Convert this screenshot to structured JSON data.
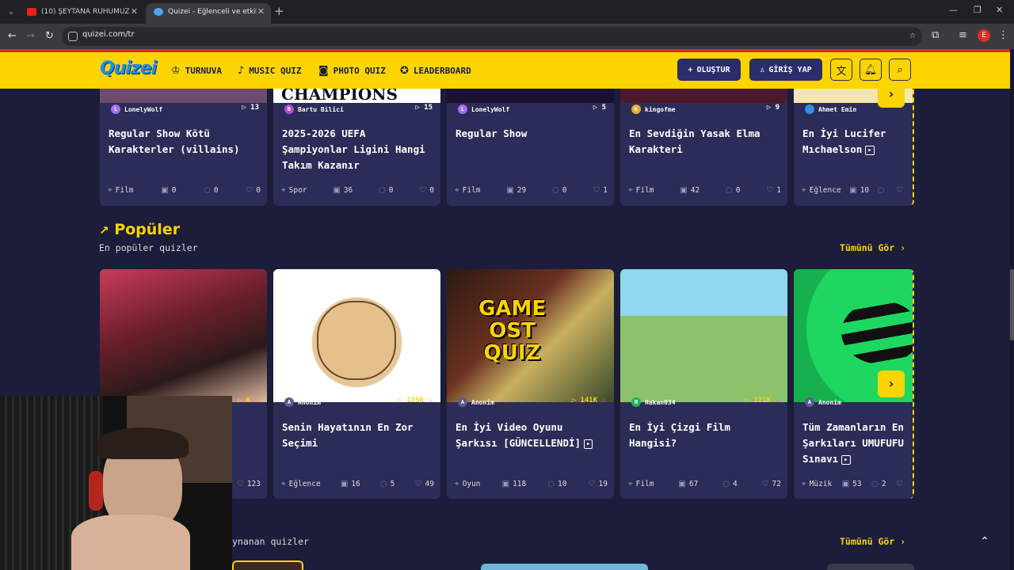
{
  "browser": {
    "tabs": [
      {
        "title": "(10) ŞEYTANA RUHUMUZU SAT"
      },
      {
        "title": "Quizei - Eğlenceli ve etkileşimli"
      }
    ],
    "url": "quizei.com/tr",
    "profile_initial": "E"
  },
  "header": {
    "logo": "Quizei",
    "nav": [
      {
        "label": "TURNUVA",
        "icon": "trophy-icon"
      },
      {
        "label": "MUSIC QUIZ",
        "icon": "music-note-icon"
      },
      {
        "label": "PHOTO QUIZ",
        "icon": "camera-icon"
      },
      {
        "label": "LEADERBOARD",
        "icon": "medal-icon"
      }
    ],
    "create_label": "OLUŞTUR",
    "login_label": "GİRİŞ YAP"
  },
  "top_row": [
    {
      "author": "LonelyWolf",
      "plays": "13",
      "title": "Regular Show Kötü Karakterler (villains)",
      "category": "Film",
      "questions": "0",
      "comments": "0",
      "likes": "0",
      "avatar_color": "#a36df0",
      "avatar_letter": "L"
    },
    {
      "author": "Bartu Bilici",
      "plays": "15",
      "title": "2025-2026 UEFA Şampiyonlar Ligini Hangi Takım Kazanır",
      "category": "Spor",
      "questions": "36",
      "comments": "0",
      "likes": "0",
      "avatar_color": "#b44ad8",
      "avatar_letter": "B",
      "banner": "CHAMPIONS"
    },
    {
      "author": "LonelyWolf",
      "plays": "5",
      "title": "Regular Show",
      "category": "Film",
      "questions": "29",
      "comments": "0",
      "likes": "1",
      "avatar_color": "#a36df0",
      "avatar_letter": "L"
    },
    {
      "author": "kingofme",
      "plays": "9",
      "title": "En Sevdiğin Yasak Elma Karakteri",
      "category": "Film",
      "questions": "42",
      "comments": "0",
      "likes": "1",
      "avatar_color": "#e8a533",
      "avatar_letter": "K"
    },
    {
      "author": "Ahmet Emin",
      "plays": "",
      "title": "En İyi Lucifer Mıchaelson",
      "category": "Eğlence",
      "questions": "10",
      "comments": "",
      "likes": "",
      "avatar_color": "#3a8de0",
      "avatar_letter": ""
    }
  ],
  "popular": {
    "title": "Popüler",
    "subtitle": "En popüler quizler",
    "see_all": "Tümünü Gör",
    "cards": [
      {
        "author": "",
        "plays": "K",
        "title": "",
        "category": "",
        "questions": "",
        "comments": "",
        "likes": "123",
        "avatar_color": "#666",
        "avatar_letter": ""
      },
      {
        "author": "Anonim",
        "plays": "155K",
        "title": "Senin Hayatının En Zor Seçimi",
        "category": "Eğlence",
        "questions": "16",
        "comments": "5",
        "likes": "49",
        "avatar_color": "#5a5c8a",
        "avatar_letter": "A"
      },
      {
        "author": "Anonim",
        "plays": "141K",
        "title": "En İyi Video Oyunu Şarkısı [GÜNCELLENDİ]",
        "category": "Oyun",
        "questions": "118",
        "comments": "10",
        "likes": "19",
        "avatar_color": "#5a5c8a",
        "avatar_letter": "A",
        "overlay": [
          "GAME",
          "OST",
          "QUIZ"
        ]
      },
      {
        "author": "Hakan034",
        "plays": "121K",
        "title": "En İyi Çizgi Film Hangisi?",
        "category": "Film",
        "questions": "67",
        "comments": "4",
        "likes": "72",
        "avatar_color": "#23b25a",
        "avatar_letter": "H"
      },
      {
        "author": "Anonim",
        "plays": "",
        "title": "Tüm Zamanların En Şarkıları UMUFUFU Sınavı",
        "category": "Müzik",
        "questions": "53",
        "comments": "2",
        "likes": "",
        "avatar_color": "#5a5c8a",
        "avatar_letter": "A"
      }
    ]
  },
  "next_section": {
    "subtitle": "ynanan quizler",
    "see_all": "Tümünü Gör"
  },
  "colors": {
    "accent": "#fcd400",
    "card": "#2b2c57",
    "bg": "#1b1d3a",
    "header_bg": "#fcd400"
  }
}
